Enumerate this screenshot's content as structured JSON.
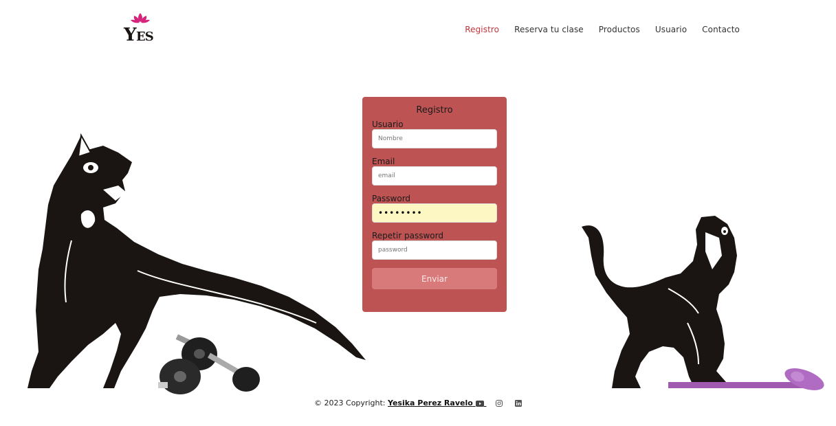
{
  "header": {
    "logo_text": "YES",
    "nav": [
      {
        "label": "Registro",
        "active": true
      },
      {
        "label": "Reserva tu clase",
        "active": false
      },
      {
        "label": "Productos",
        "active": false
      },
      {
        "label": "Usuario",
        "active": false
      },
      {
        "label": "Contacto",
        "active": false
      }
    ]
  },
  "form": {
    "title": "Registro",
    "fields": [
      {
        "label": "Usuario",
        "placeholder": "Nombre",
        "value": ""
      },
      {
        "label": "Email",
        "placeholder": "email",
        "value": ""
      },
      {
        "label": "Password",
        "placeholder": "",
        "value": "••••••••"
      },
      {
        "label": "Repetir password",
        "placeholder": "password",
        "value": ""
      }
    ],
    "submit_label": "Enviar"
  },
  "footer": {
    "copyright": "© 2023 Copyright:",
    "author": "Yesika Perez Ravelo",
    "icons": [
      "youtube-icon",
      "instagram-icon",
      "linkedin-icon"
    ]
  },
  "colors": {
    "accent": "#c0353b",
    "card_bg": "#bd5453",
    "button_bg": "#d97a7a",
    "autofill_bg": "#fdf8c3",
    "lotus": "#d6247d"
  }
}
